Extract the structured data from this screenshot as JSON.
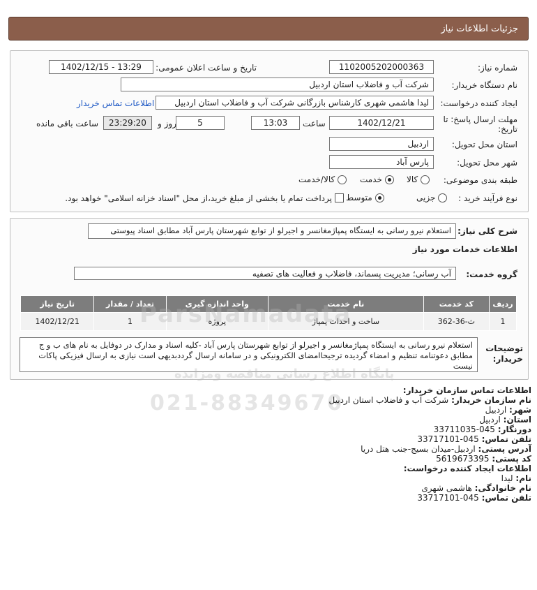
{
  "header": {
    "title": "جزئیات اطلاعات نیاز"
  },
  "need": {
    "need_number_label": "شماره نیاز:",
    "need_number": "1102005202000363",
    "announce_label": "تاریخ و ساعت اعلان عمومی:",
    "announce_value": "1402/12/15 - 13:29",
    "buyer_org_label": "نام دستگاه خریدار:",
    "buyer_org": "شرکت آب و فاضلاب استان اردبیل",
    "creator_label": "ایجاد کننده درخواست:",
    "creator": "لیدا  هاشمی شهری کارشناس بازرگانی شرکت آب و فاضلاب استان اردبیل",
    "contact_link": "اطلاعات تماس خریدار",
    "deadline_label_1": "مهلت ارسال پاسخ: تا",
    "deadline_label_2": "تاریخ:",
    "deadline_date": "1402/12/21",
    "time_label": "ساعت",
    "deadline_time": "13:03",
    "days": "5",
    "days_label": "روز و",
    "remaining_time": "23:29:20",
    "remaining_label": "ساعت باقی مانده",
    "province_label": "استان محل تحویل:",
    "province": "اردبیل",
    "city_label": "شهر محل تحویل:",
    "city": "پارس آباد",
    "category_label": "طبقه بندی موضوعی:",
    "category_options": [
      "کالا",
      "خدمت",
      "کالا/خدمت"
    ],
    "category_selected": "خدمت",
    "process_label": "نوع فرآیند خرید :",
    "process_options": [
      "جزیی",
      "متوسط"
    ],
    "process_selected": "متوسط",
    "payment_note": "پرداخت تمام یا بخشی از مبلغ خرید،از محل \"اسناد خزانه اسلامی\" خواهد بود."
  },
  "summary": {
    "label": "شرح کلی نیاز:",
    "text": "استعلام نیرو رسانی به ایستگاه پمپاژمغانسر و اجیرلو از توابع شهرستان پارس آباد مطابق اسناد پیوستی"
  },
  "services": {
    "section_title": "اطلاعات خدمات مورد نیاز",
    "group_label": "گروه خدمت:",
    "group_value": "آب رسانی؛ مدیریت پسماند، فاضلاب و فعالیت های تصفیه",
    "table": {
      "headers": [
        "ردیف",
        "کد خدمت",
        "نام خدمت",
        "واحد اندازه گیری",
        "تعداد / مقدار",
        "تاریخ نیاز"
      ],
      "rows": [
        [
          "1",
          "ث-36-362",
          "ساخت و احداث پمپاژ",
          "پروژه",
          "1",
          "1402/12/21"
        ]
      ]
    }
  },
  "buyer_notes": {
    "label": "توضیحات خریدار:",
    "text": "استعلام نیرو رسانی به ایستگاه پمپاژمغانسر و اجیرلو از توابع شهرستان پارس آباد -کلیه اسناد و مدارک در دوفایل به نام های ب و ج مطابق دعوتنامه تنظیم و امضاء گردیده ترجیحاامضای الکترونیکی و در سامانه ارسال گرددبدیهی است نیازی به ارسال فیزیکی پاکات نیست"
  },
  "contact": {
    "title": "اطلاعات تماس سازمان خریدار:",
    "org_label": "نام سازمان خریدار:",
    "org": "شرکت آب و فاضلاب استان اردبیل",
    "city_label": "شهر:",
    "city": "اردبیل",
    "province_label": "استان:",
    "province": "اردبیل",
    "fax_label": "دورنگار:",
    "fax": "045-33711035",
    "phone_label": "تلفن تماس:",
    "phone": "045-33717101",
    "address_label": "آدرس پستی:",
    "address": "اردبیل-میدان بسیج-جنب هتل دریا",
    "postal_label": "کد پستی:",
    "postal": "5619673395",
    "creator_title": "اطلاعات ایجاد کننده درخواست:",
    "name_label": "نام:",
    "name": "لیدا",
    "family_label": "نام خانوادگی:",
    "family": "هاشمی شهری",
    "creator_phone_label": "تلفن تماس:",
    "creator_phone": "045-33717101"
  },
  "watermark": {
    "site": "ParsNamadata",
    "subtitle": "پایگاه اطلاع رسانی مناقصه ومزایده",
    "phone": "021-88349670"
  }
}
